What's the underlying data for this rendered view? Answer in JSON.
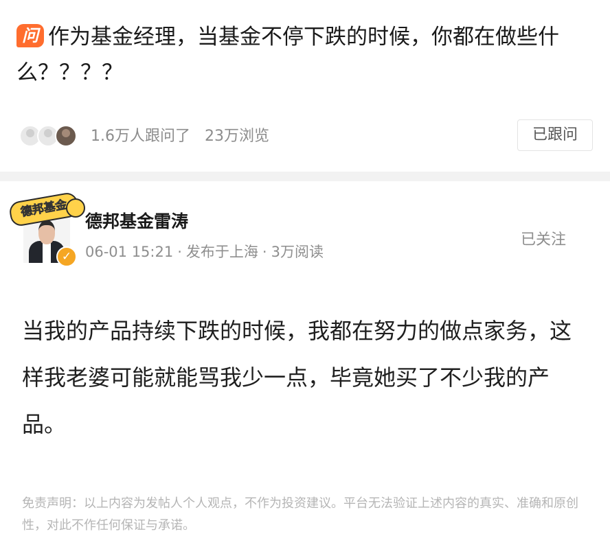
{
  "question": {
    "badge": "问",
    "title": "作为基金经理，当基金不停下跌的时候，你都在做些什么？？？？"
  },
  "stats": {
    "followers": "1.6万人跟问了",
    "views": "23万浏览",
    "follow_button": "已跟问"
  },
  "author": {
    "brand_tag": "德邦基金",
    "verified_mark": "✓",
    "name": "德邦基金雷涛",
    "date": "06-01 15:21",
    "location": "发布于上海",
    "reads": "3万阅读",
    "separator": "·",
    "follow_status": "已关注"
  },
  "answer": {
    "text": "当我的产品持续下跌的时候，我都在努力的做点家务，这样我老婆可能就能骂我少一点，毕竟她买了不少我的产品。"
  },
  "disclaimer": {
    "text": "免责声明：以上内容为发帖人个人观点，不作为投资建议。平台无法验证上述内容的真实、准确和原创性，对此不作任何保证与承诺。"
  },
  "colors": {
    "badge": "#ff6d2e",
    "verified": "#f5a623",
    "brand_tag": "#ffd24a",
    "muted_text": "#8e8e8e"
  },
  "icons": {
    "question_badge": "question-badge-icon",
    "verified": "verified-badge-icon",
    "mascot": "mascot-icon"
  }
}
